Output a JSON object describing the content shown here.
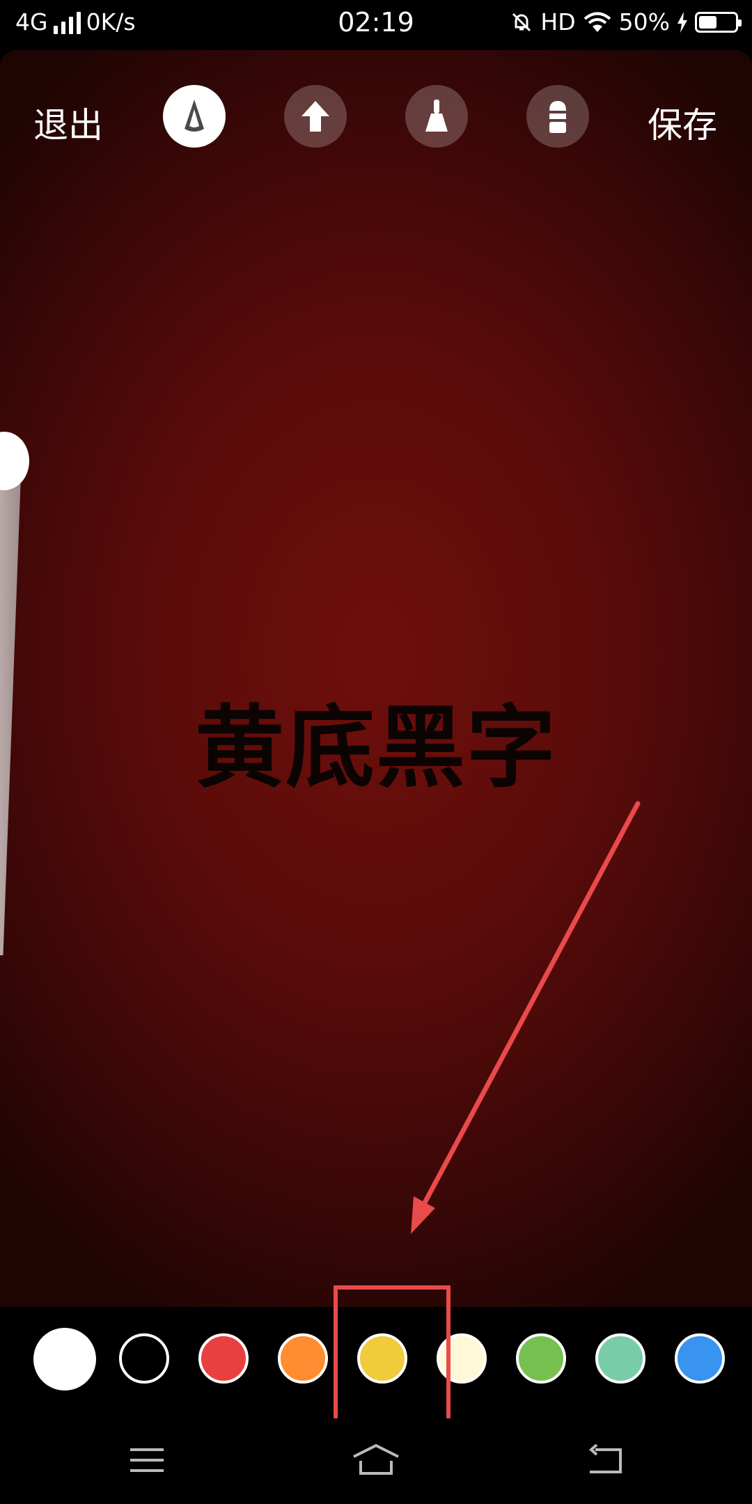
{
  "status_bar": {
    "network": "4G",
    "speed": "0K/s",
    "time": "02:19",
    "hd": "HD",
    "battery_percent": "50%",
    "battery_level": 0.5
  },
  "toolbar": {
    "exit_label": "退出",
    "save_label": "保存",
    "tools": [
      {
        "name": "pen-tool",
        "active": true
      },
      {
        "name": "arrow-tool",
        "active": false
      },
      {
        "name": "brush-tool",
        "active": false
      },
      {
        "name": "eraser-tool",
        "active": false
      }
    ]
  },
  "canvas": {
    "text": "黄底黑字",
    "background_color": "#5c0c0a"
  },
  "palette": {
    "colors": [
      "#ffffff",
      "#000000",
      "#e84040",
      "#ff8c30",
      "#f0cc3c",
      "#fff8d8",
      "#76c050",
      "#78cca8",
      "#3894ee"
    ],
    "selected_index": 0,
    "highlighted_index": 4
  },
  "annotation": {
    "color": "#e94a4a"
  }
}
